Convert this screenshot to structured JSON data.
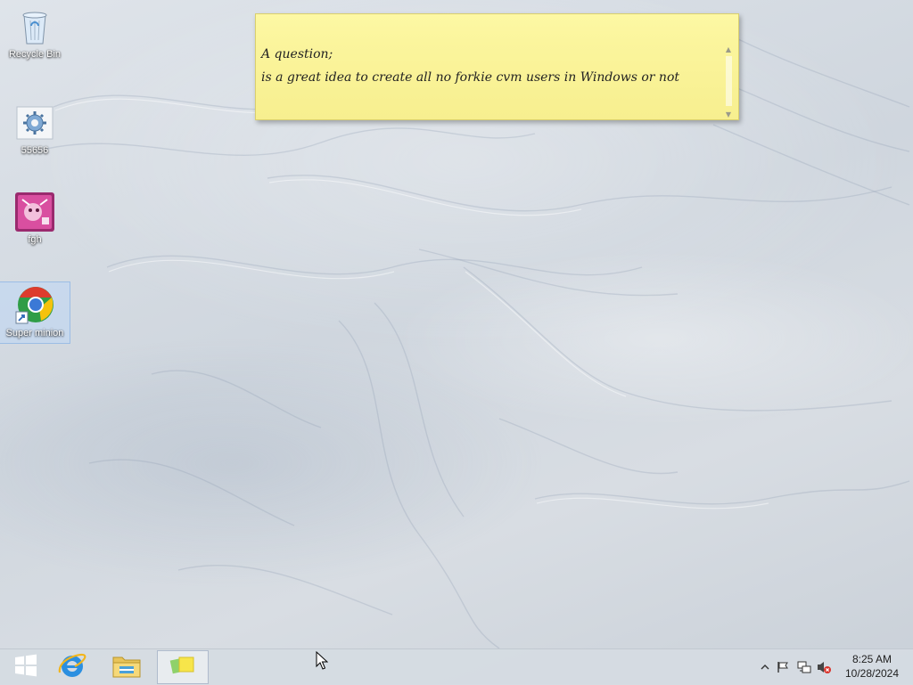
{
  "desktop": {
    "icons": [
      {
        "label": "Recycle Bin",
        "icon": "recycle-bin-icon"
      },
      {
        "label": "55656",
        "icon": "settings-gear-icon"
      },
      {
        "label": "fgh",
        "icon": "pink-app-icon"
      },
      {
        "label": "Super minion",
        "icon": "chrome-shortcut-icon",
        "selected": true
      }
    ]
  },
  "sticky_note": {
    "line1": "A question;",
    "line2": "is a great idea to create all no forkie cvm users in Windows or not",
    "color": "#fbf59d"
  },
  "taskbar": {
    "buttons": [
      {
        "name": "start",
        "icon": "windows-logo-icon"
      },
      {
        "name": "internet-explorer",
        "icon": "ie-icon"
      },
      {
        "name": "file-explorer",
        "icon": "folder-icon"
      },
      {
        "name": "sticky-notes",
        "icon": "sticky-notes-icon",
        "active": true
      }
    ],
    "tray": {
      "icons": [
        "show-hidden-icons-chevron",
        "action-center-flag-icon",
        "network-icon",
        "volume-muted-icon"
      ],
      "time": "8:25 AM",
      "date": "10/28/2024"
    }
  }
}
